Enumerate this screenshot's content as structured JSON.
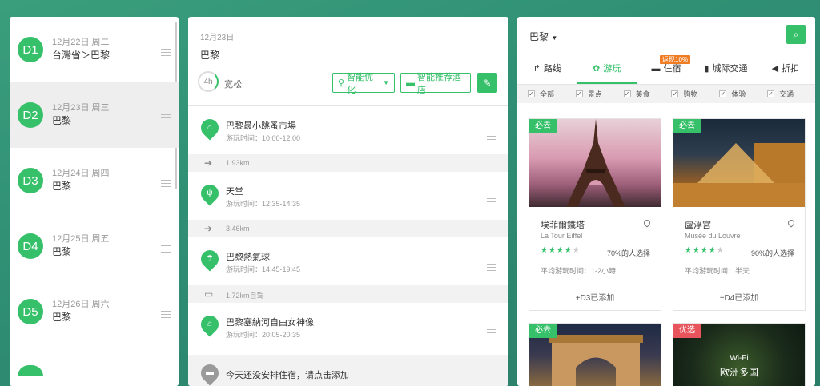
{
  "days": [
    {
      "badge": "D1",
      "date": "12月22日 周二",
      "city": "台灣省＞巴黎"
    },
    {
      "badge": "D2",
      "date": "12月23日 周三",
      "city": "巴黎"
    },
    {
      "badge": "D3",
      "date": "12月24日 周四",
      "city": "巴黎"
    },
    {
      "badge": "D4",
      "date": "12月25日 周五",
      "city": "巴黎"
    },
    {
      "badge": "D5",
      "date": "12月26日 周六",
      "city": "巴黎"
    }
  ],
  "day_detail": {
    "date": "12月23日",
    "city": "巴黎",
    "duration": "4h",
    "pace": "宽松",
    "optimize_label": "智能优化",
    "hotel_label": "智能推荐酒店",
    "edit_icon": "pencil-icon"
  },
  "pois": [
    {
      "name": "巴黎最小跳蚤市場",
      "time": "游玩时间：10:00-12:00",
      "icon": "building-icon"
    },
    {
      "name": "天堂",
      "time": "游玩时间：12:35-14:35",
      "icon": "utensils-icon"
    },
    {
      "name": "巴黎熱氣球",
      "time": "游玩时间：14:45-19:45",
      "icon": "balloon-icon"
    },
    {
      "name": "巴黎塞納河自由女神像",
      "time": "游玩时间：20:05-20:35",
      "icon": "monument-icon"
    }
  ],
  "transits": [
    {
      "distance": "1.93km",
      "icon": "arrow-right-icon"
    },
    {
      "distance": "3.46km",
      "icon": "arrow-right-icon"
    },
    {
      "distance": "1.72km自驾",
      "icon": "car-icon"
    }
  ],
  "no_hotel_text": "今天还没安排住宿，请点击添加",
  "explore": {
    "city": "巴黎",
    "tabs": [
      {
        "label": "路线",
        "icon": "route-icon"
      },
      {
        "label": "游玩",
        "icon": "attraction-icon"
      },
      {
        "label": "住宿",
        "icon": "bed-icon"
      },
      {
        "label": "城际交通",
        "icon": "transport-icon"
      },
      {
        "label": "折扣",
        "icon": "tag-icon"
      }
    ],
    "promo": "返现10%",
    "filters": [
      "全部",
      "景点",
      "美食",
      "购物",
      "体验",
      "交通"
    ]
  },
  "cards": [
    {
      "badge": "必去",
      "name": "埃菲爾鐵塔",
      "sub": "La Tour Eiffel",
      "stars": 4,
      "pct": "70%的人选择",
      "avg": "平均游玩时间：1-2小時",
      "foot": "+D3已添加"
    },
    {
      "badge": "必去",
      "name": "盧浮宮",
      "sub": "Musée du Louvre",
      "stars": 4,
      "pct": "90%的人选择",
      "avg": "平均游玩时间：半天",
      "foot": "+D4已添加"
    },
    {
      "badge": "必去",
      "name": "",
      "sub": "",
      "stars": 0,
      "pct": "",
      "avg": "",
      "foot": ""
    },
    {
      "badge": "优选",
      "name": "",
      "sub": "",
      "stars": 0,
      "pct": "",
      "avg": "",
      "foot": "",
      "img_text_1": "Wi-Fi",
      "img_text_2": "欧洲多国"
    }
  ]
}
